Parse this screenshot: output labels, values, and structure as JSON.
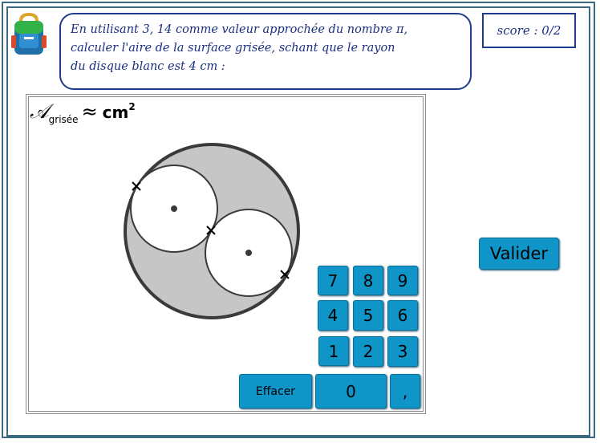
{
  "question": {
    "line1": "En utilisant 3, 14 comme valeur approchée du nombre π,",
    "line2": "calculer l'aire de la surface grisée, schant que le rayon",
    "line3": "du disque blanc est 4 cm :"
  },
  "score": {
    "label": "score : 0/2"
  },
  "formula": {
    "symbol": "𝒜",
    "subscript": "grisée",
    "approx": "≈",
    "unit": "cm",
    "exponent": "2"
  },
  "keypad": {
    "row1": [
      "7",
      "8",
      "9"
    ],
    "row2": [
      "4",
      "5",
      "6"
    ],
    "row3": [
      "1",
      "2",
      "3"
    ],
    "clear_label": "Effacer",
    "zero_label": "0",
    "comma_label": ","
  },
  "validate_label": "Valider",
  "colors": {
    "key_blue": "#0f95c8",
    "text_blue": "#1a2f82",
    "frame": "#3c6a80",
    "shaded": "#c6c6c6"
  },
  "icons": {
    "logo": "school-backpack-icon"
  }
}
